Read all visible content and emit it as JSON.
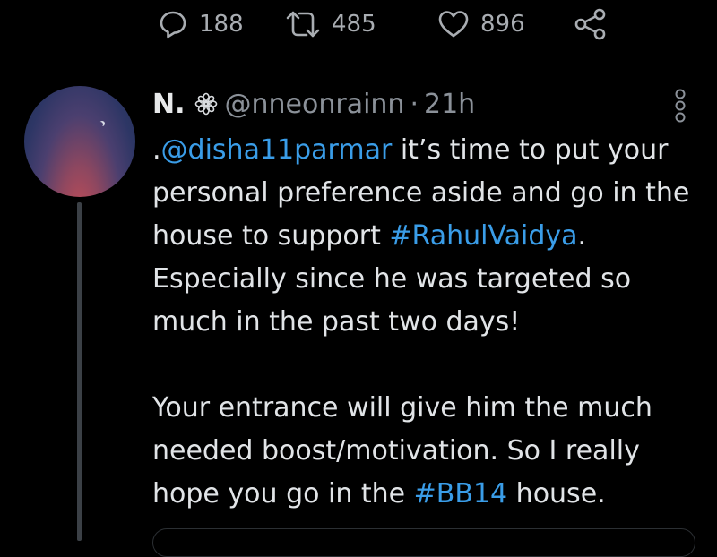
{
  "actions": {
    "reply": {
      "icon": "reply-icon",
      "count": "188"
    },
    "retweet": {
      "icon": "retweet-icon",
      "count": "485"
    },
    "like": {
      "icon": "heart-icon",
      "count": "896"
    },
    "share": {
      "icon": "share-icon"
    }
  },
  "tweet": {
    "name": "N.",
    "name_icon": "flower-icon",
    "handle": "@nneonrainn",
    "separator": "·",
    "time": "21h",
    "paragraph1": {
      "prefix": ".",
      "mention": "@disha11parmar",
      "text1": " it’s time to put your personal preference aside and go in the house to support ",
      "hashtag": "#RahulVaidya",
      "text2": ". Especially since he was targeted so much in the past two days!"
    },
    "paragraph2": {
      "text1": "Your entrance will give him the much needed boost/motivation. So I really hope you go in the ",
      "hashtag": "#BB14",
      "text2": " house."
    }
  },
  "colors": {
    "background": "#000000",
    "text": "#e1e4e7",
    "muted": "#8b9199",
    "link": "#3a9de8"
  }
}
